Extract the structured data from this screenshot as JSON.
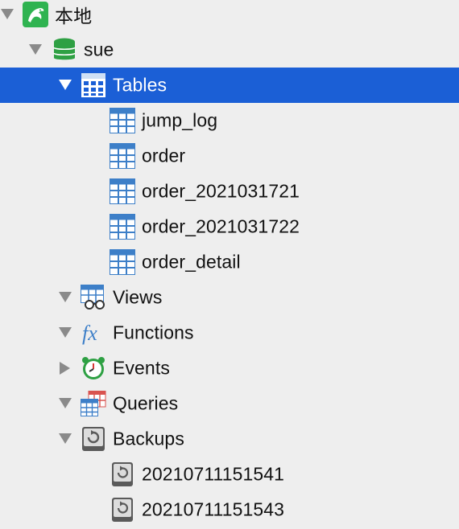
{
  "tree": {
    "connection": {
      "label": "本地",
      "icon": "mysql-dolphin-icon",
      "expanded": true
    },
    "database": {
      "label": "sue",
      "icon": "database-icon",
      "expanded": true
    },
    "tables": {
      "label": "Tables",
      "icon": "table-group-icon",
      "expanded": true,
      "selected": true,
      "items": [
        "jump_log",
        "order",
        "order_2021031721",
        "order_2021031722",
        "order_detail"
      ]
    },
    "views": {
      "label": "Views",
      "icon": "views-icon",
      "expanded": true
    },
    "functions": {
      "label": "Functions",
      "icon": "function-icon",
      "expanded": true
    },
    "events": {
      "label": "Events",
      "icon": "alarm-clock-icon",
      "expanded": false
    },
    "queries": {
      "label": "Queries",
      "icon": "queries-icon",
      "expanded": true
    },
    "backups": {
      "label": "Backups",
      "icon": "backup-icon",
      "expanded": true,
      "items": [
        "20210711151541",
        "20210711151543"
      ]
    }
  },
  "colors": {
    "selection": "#1b5fd6",
    "background": "#eeeeee",
    "table_icon": "#3d7fc8",
    "database_icon": "#2ea043"
  }
}
